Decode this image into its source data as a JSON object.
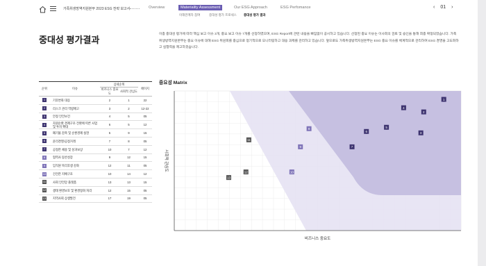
{
  "nav": {
    "report_title": "가족위생방역지원본부 2023 ESG 전략 보고서",
    "tabs": [
      "Overview",
      "Materiality Assessment",
      "Our ESG Approach",
      "ESG Perfomance"
    ],
    "sub_tabs": [
      "이해관계자 참여",
      "중대성 평가 프로세스",
      "중대성 평가 결과"
    ],
    "page_number": "01"
  },
  "page_title": "중대성 평가결과",
  "intro": "이종 중대성 평가에 따라 핵심 보고 이슈 3개, 중요 보고 이슈 7개를 선정하였으며, ESG Report에 관련 내용을 빠짐없이 공시하고 있습니다. 선정된 중요 이슈는 이사회의 검토 및 승인을 통해 최종 확정되었습니다. 가족위생방역지원본부는 중요 이슈에 대해 ESG 위원회를 중심으로 정기적으로 모니터링하고 대응 과제를 관리하고 있습니다. 앞으로도 가족위생방역지원본부는 ESG 중요 이슈를 체계적으로 관리하여 ESG 경영을 고도화하고 실행력을 제고하겠습니다.",
  "table": {
    "headers": {
      "rank": "순위",
      "issue": "이슈",
      "detail_rank": "상세순위",
      "business": "비즈니스 중요도",
      "social": "사회적 관심도",
      "page": "페이지"
    },
    "rows": [
      {
        "rank": "1",
        "issue": "기후변화 대응",
        "business": "2",
        "social": "1",
        "page": "22"
      },
      {
        "rank": "2",
        "issue": "리스크 관리 역량제고",
        "business": "3",
        "social": "2",
        "page": "12-22"
      },
      {
        "rank": "3",
        "issue": "안정 안전보건",
        "business": "4",
        "social": "5",
        "page": "05"
      },
      {
        "rank": "4",
        "issue": "자원순환 경제구조 전환에 따른 사업 및 투자 확대",
        "business": "6",
        "social": "5",
        "page": "12"
      },
      {
        "rank": "5",
        "issue": "폐기물 감축 및 순환경제 실현",
        "business": "5",
        "social": "9",
        "page": "15"
      },
      {
        "rank": "6",
        "issue": "윤리경영/공정거래",
        "business": "7",
        "social": "8",
        "page": "05"
      },
      {
        "rank": "7",
        "issue": "공정한 채용 및 성과보상",
        "business": "10",
        "social": "7",
        "page": "12"
      },
      {
        "rank": "8",
        "issue": "협력사 동반성장",
        "business": "9",
        "social": "12",
        "page": "15"
      },
      {
        "rank": "9",
        "issue": "임직원 복리후생 강화",
        "business": "12",
        "social": "11",
        "page": "05"
      },
      {
        "rank": "10",
        "issue": "건전한 지배구조",
        "business": "10",
        "social": "14",
        "page": "12"
      },
      {
        "rank": "11",
        "issue": "사회 안전망 플랫폼",
        "business": "13",
        "social": "13",
        "page": "15"
      },
      {
        "rank": "12",
        "issue": "생태 환경보호 및 환경정화 처리",
        "business": "12",
        "social": "15",
        "page": "05"
      },
      {
        "rank": "13",
        "issue": "지역사회 상생발전",
        "business": "17",
        "social": "19",
        "page": "05"
      }
    ]
  },
  "matrix": {
    "title": "중요성 Matrix",
    "x_label": "비즈니스 중요도",
    "y_label": "사회적 관심도",
    "points": [
      {
        "label": "1",
        "business": 0.94,
        "social": 0.94,
        "tier": "core"
      },
      {
        "label": "2",
        "business": 0.87,
        "social": 0.85,
        "tier": "core"
      },
      {
        "label": "3",
        "business": 0.86,
        "social": 0.7,
        "tier": "core"
      },
      {
        "label": "4",
        "business": 0.8,
        "social": 0.88,
        "tier": "core"
      },
      {
        "label": "5",
        "business": 0.74,
        "social": 0.74,
        "tier": "core"
      },
      {
        "label": "6",
        "business": 0.67,
        "social": 0.71,
        "tier": "core"
      },
      {
        "label": "7",
        "business": 0.62,
        "social": 0.6,
        "tier": "core"
      },
      {
        "label": "8",
        "business": 0.47,
        "social": 0.73,
        "tier": "major"
      },
      {
        "label": "9",
        "business": 0.44,
        "social": 0.6,
        "tier": "major"
      },
      {
        "label": "10",
        "business": 0.41,
        "social": 0.42,
        "tier": "major"
      },
      {
        "label": "11",
        "business": 0.26,
        "social": 0.65,
        "tier": "other"
      },
      {
        "label": "12",
        "business": 0.25,
        "social": 0.42,
        "tier": "other"
      },
      {
        "label": "13",
        "business": 0.19,
        "social": 0.38,
        "tier": "other"
      }
    ]
  },
  "colors": {
    "accent": "#6a5db2",
    "core": "#3e3470",
    "major": "#7f74b8",
    "other": "#555555",
    "zone_light": "#e6e2f3",
    "zone_dark": "#c2bbdf"
  }
}
